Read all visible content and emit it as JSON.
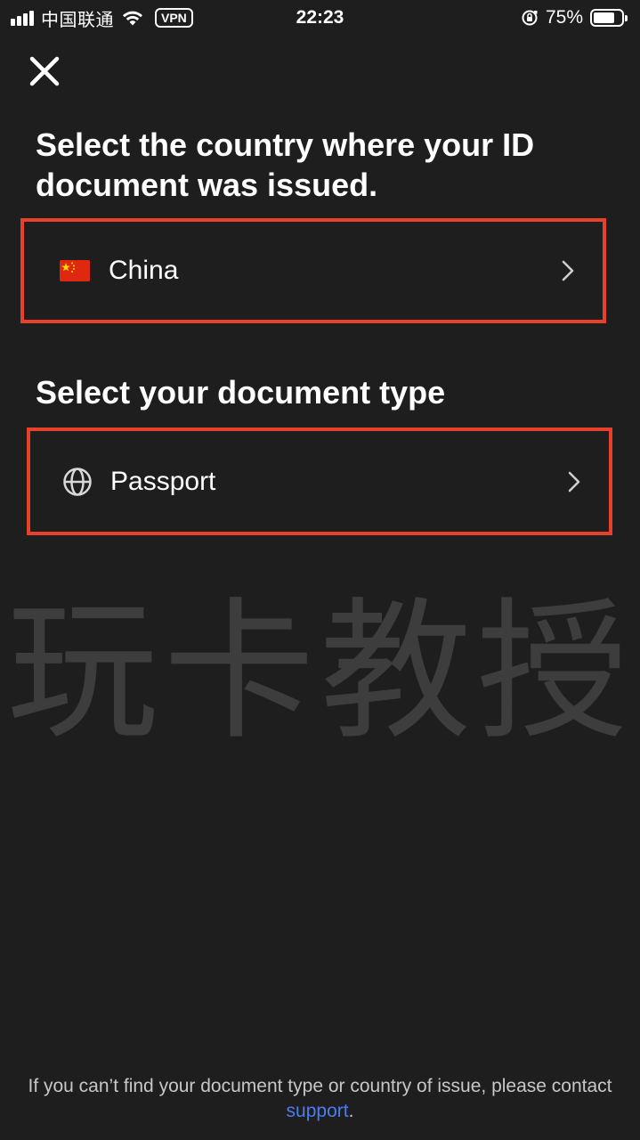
{
  "status_bar": {
    "carrier": "中国联通",
    "vpn": "VPN",
    "time": "22:23",
    "battery": "75%",
    "battery_level": 0.75
  },
  "header": {
    "close_icon": "close-icon"
  },
  "country_section": {
    "title": "Select the country where your ID document was issued.",
    "selected_country": "China",
    "flag_icon": "china-flag-icon",
    "chevron_icon": "chevron-right-icon"
  },
  "document_section": {
    "title": "Select your document type",
    "selected_type": "Passport",
    "type_icon": "globe-icon",
    "chevron_icon": "chevron-right-icon"
  },
  "watermark": "玩卡教授",
  "footer": {
    "text_before": "If you can’t find your document type or country of issue, please contact ",
    "link_label": "support",
    "text_after": "."
  },
  "colors": {
    "background": "#1e1e1e",
    "highlight_border": "#e8402a",
    "link": "#4d7cf0"
  }
}
